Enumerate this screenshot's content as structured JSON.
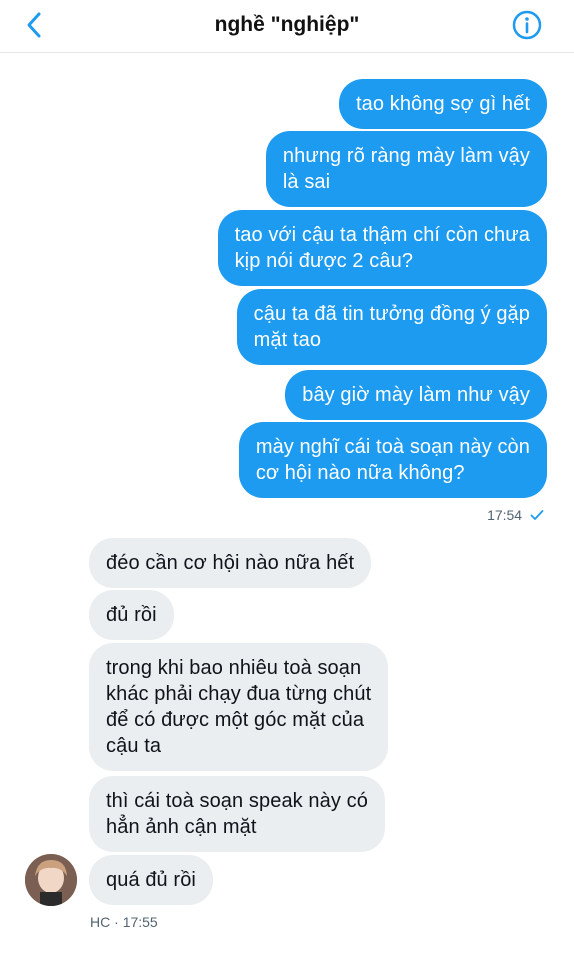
{
  "header": {
    "title": "nghề \"nghiệp\"",
    "back_icon": "chevron-left-icon",
    "info_icon": "info-icon",
    "accent_color": "#1d9bf0"
  },
  "messages": {
    "sent": [
      "tao không sợ gì hết",
      "nhưng rõ ràng mày làm vậy\nlà sai",
      "tao với cậu ta thậm chí còn chưa\nkịp nói được 2 câu?",
      "cậu ta đã tin tưởng đồng ý gặp\nmặt tao",
      "bây giờ mày làm như vậy",
      "mày nghĩ cái toà soạn này còn\ncơ hội nào nữa không?"
    ],
    "sent_time": "17:54",
    "sent_status_icon": "check-icon",
    "received": [
      "đéo cần cơ hội nào nữa hết",
      "đủ rồi",
      "trong khi bao nhiêu toà soạn\nkhác phải chạy đua từng chút\nđể có được một góc mặt của\ncậu ta",
      "thì cái toà soạn speak này có\nhẳn ảnh cận mặt",
      "quá đủ rồi"
    ],
    "received_sender": "HC",
    "received_separator": "·",
    "received_time": "17:55"
  }
}
